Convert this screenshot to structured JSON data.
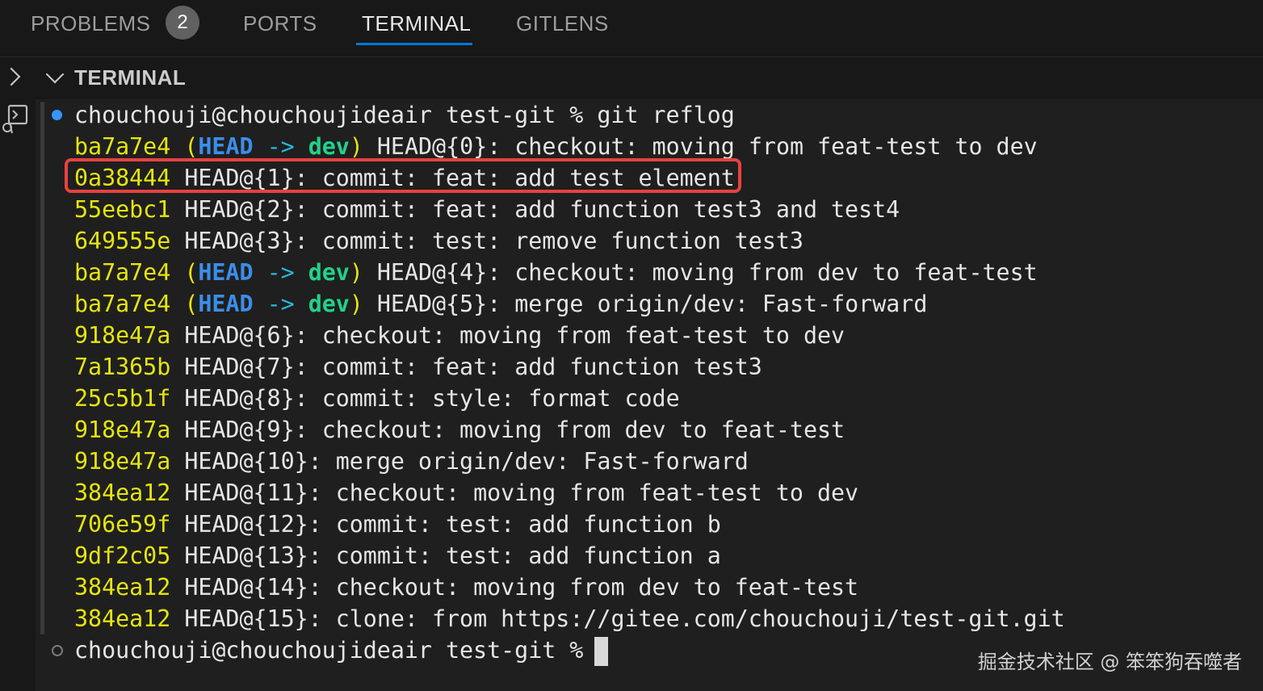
{
  "tabs": [
    {
      "label": "PROBLEMS",
      "badge": "2"
    },
    {
      "label": "PORTS"
    },
    {
      "label": "TERMINAL",
      "active": true
    },
    {
      "label": "GITLENS"
    }
  ],
  "section": {
    "title": "TERMINAL"
  },
  "terminal": {
    "prompt": "chouchouji@chouchoujideair test-git % ",
    "command": "git reflog",
    "reflog": [
      {
        "hash": "ba7a7e4",
        "ref": "HEAD@{0}",
        "message": "checkout: moving from feat-test to dev",
        "decorated": true
      },
      {
        "hash": "0a38444",
        "ref": "HEAD@{1}",
        "message": "commit: feat: add test element",
        "highlighted": true
      },
      {
        "hash": "55eebc1",
        "ref": "HEAD@{2}",
        "message": "commit: feat: add function test3 and test4"
      },
      {
        "hash": "649555e",
        "ref": "HEAD@{3}",
        "message": "commit: test: remove function test3"
      },
      {
        "hash": "ba7a7e4",
        "ref": "HEAD@{4}",
        "message": "checkout: moving from dev to feat-test",
        "decorated": true
      },
      {
        "hash": "ba7a7e4",
        "ref": "HEAD@{5}",
        "message": "merge origin/dev: Fast-forward",
        "decorated": true
      },
      {
        "hash": "918e47a",
        "ref": "HEAD@{6}",
        "message": "checkout: moving from feat-test to dev"
      },
      {
        "hash": "7a1365b",
        "ref": "HEAD@{7}",
        "message": "commit: feat: add function test3"
      },
      {
        "hash": "25c5b1f",
        "ref": "HEAD@{8}",
        "message": "commit: style: format code"
      },
      {
        "hash": "918e47a",
        "ref": "HEAD@{9}",
        "message": "checkout: moving from dev to feat-test"
      },
      {
        "hash": "918e47a",
        "ref": "HEAD@{10}",
        "message": "merge origin/dev: Fast-forward"
      },
      {
        "hash": "384ea12",
        "ref": "HEAD@{11}",
        "message": "checkout: moving from feat-test to dev"
      },
      {
        "hash": "706e59f",
        "ref": "HEAD@{12}",
        "message": "commit: test: add function b"
      },
      {
        "hash": "9df2c05",
        "ref": "HEAD@{13}",
        "message": "commit: test: add function a"
      },
      {
        "hash": "384ea12",
        "ref": "HEAD@{14}",
        "message": "checkout: moving from dev to feat-test"
      },
      {
        "hash": "384ea12",
        "ref": "HEAD@{15}",
        "message": "clone: from https://gitee.com/chouchouji/test-git.git"
      }
    ],
    "decoration": {
      "head": "HEAD",
      "arrow": "->",
      "branch": "dev"
    },
    "final_prompt": "chouchouji@chouchoujideair test-git %"
  },
  "icons": {
    "collapse_panel": "chevron-right-icon",
    "section_toggle": "chevron-down-icon",
    "terminal_session": "terminal-icon"
  },
  "colors": {
    "hash": "#e5e510",
    "head": "#3b8eea",
    "branch": "#23d18b",
    "highlight_border": "#e8423f",
    "active_tab_underline": "#0078d4"
  },
  "watermark": "掘金技术社区 @ 笨笨狗吞噬者"
}
